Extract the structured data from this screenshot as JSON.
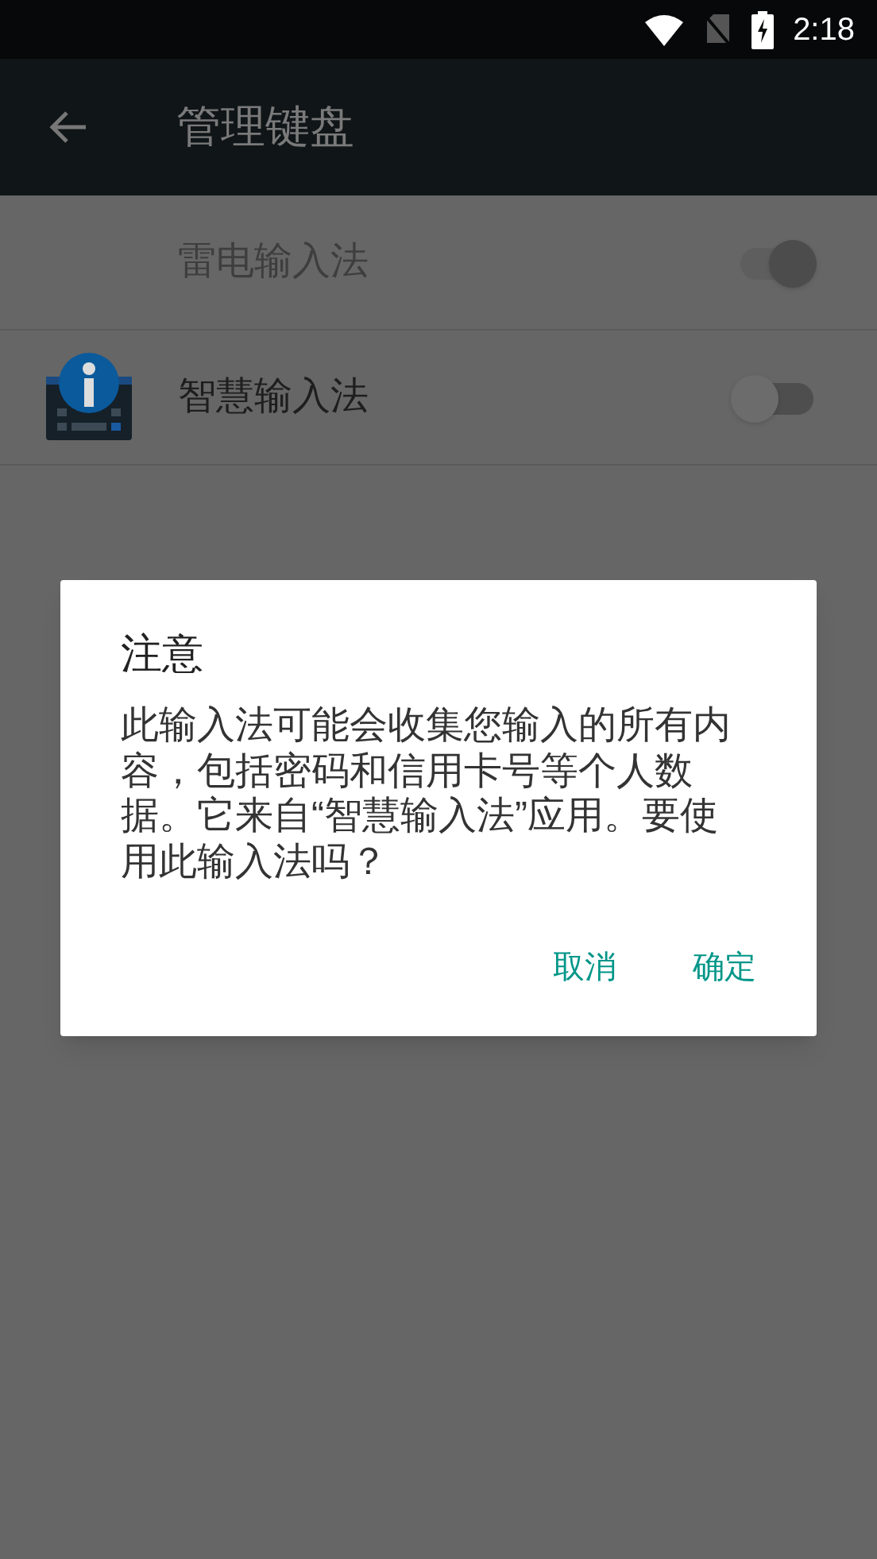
{
  "status_bar": {
    "time": "2:18"
  },
  "app_bar": {
    "title": "管理键盘"
  },
  "keyboards": [
    {
      "name": "雷电输入法",
      "disabled": true,
      "on": true,
      "has_icon": false
    },
    {
      "name": "智慧输入法",
      "disabled": false,
      "on": false,
      "has_icon": true
    }
  ],
  "dialog": {
    "title": "注意",
    "message": "此输入法可能会收集您输入的所有内容，包括密码和信用卡号等个人数据。它来自“智慧输入法”应用。要使用此输入法吗？",
    "buttons": [
      "取消",
      "确定"
    ]
  }
}
